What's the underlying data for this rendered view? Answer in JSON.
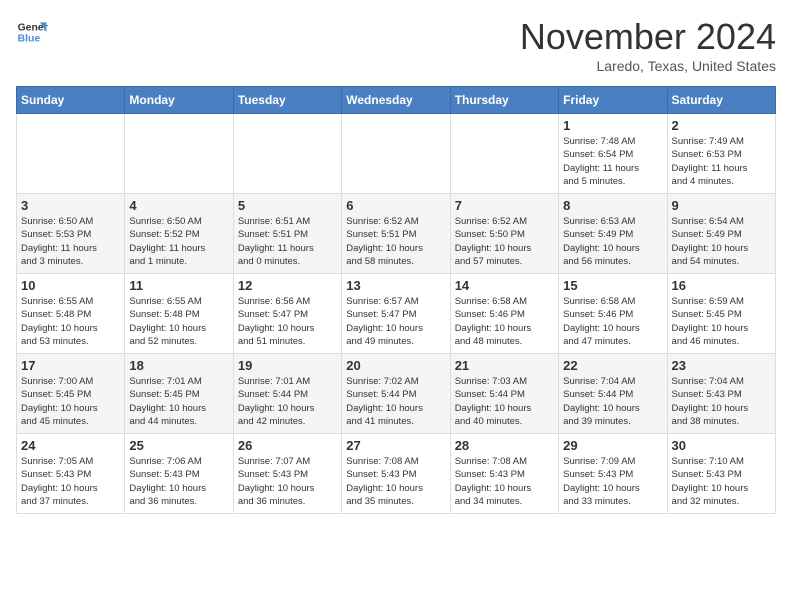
{
  "header": {
    "logo_line1": "General",
    "logo_line2": "Blue",
    "month": "November 2024",
    "location": "Laredo, Texas, United States"
  },
  "weekdays": [
    "Sunday",
    "Monday",
    "Tuesday",
    "Wednesday",
    "Thursday",
    "Friday",
    "Saturday"
  ],
  "weeks": [
    [
      {
        "day": "",
        "info": ""
      },
      {
        "day": "",
        "info": ""
      },
      {
        "day": "",
        "info": ""
      },
      {
        "day": "",
        "info": ""
      },
      {
        "day": "",
        "info": ""
      },
      {
        "day": "1",
        "info": "Sunrise: 7:48 AM\nSunset: 6:54 PM\nDaylight: 11 hours\nand 5 minutes."
      },
      {
        "day": "2",
        "info": "Sunrise: 7:49 AM\nSunset: 6:53 PM\nDaylight: 11 hours\nand 4 minutes."
      }
    ],
    [
      {
        "day": "3",
        "info": "Sunrise: 6:50 AM\nSunset: 5:53 PM\nDaylight: 11 hours\nand 3 minutes."
      },
      {
        "day": "4",
        "info": "Sunrise: 6:50 AM\nSunset: 5:52 PM\nDaylight: 11 hours\nand 1 minute."
      },
      {
        "day": "5",
        "info": "Sunrise: 6:51 AM\nSunset: 5:51 PM\nDaylight: 11 hours\nand 0 minutes."
      },
      {
        "day": "6",
        "info": "Sunrise: 6:52 AM\nSunset: 5:51 PM\nDaylight: 10 hours\nand 58 minutes."
      },
      {
        "day": "7",
        "info": "Sunrise: 6:52 AM\nSunset: 5:50 PM\nDaylight: 10 hours\nand 57 minutes."
      },
      {
        "day": "8",
        "info": "Sunrise: 6:53 AM\nSunset: 5:49 PM\nDaylight: 10 hours\nand 56 minutes."
      },
      {
        "day": "9",
        "info": "Sunrise: 6:54 AM\nSunset: 5:49 PM\nDaylight: 10 hours\nand 54 minutes."
      }
    ],
    [
      {
        "day": "10",
        "info": "Sunrise: 6:55 AM\nSunset: 5:48 PM\nDaylight: 10 hours\nand 53 minutes."
      },
      {
        "day": "11",
        "info": "Sunrise: 6:55 AM\nSunset: 5:48 PM\nDaylight: 10 hours\nand 52 minutes."
      },
      {
        "day": "12",
        "info": "Sunrise: 6:56 AM\nSunset: 5:47 PM\nDaylight: 10 hours\nand 51 minutes."
      },
      {
        "day": "13",
        "info": "Sunrise: 6:57 AM\nSunset: 5:47 PM\nDaylight: 10 hours\nand 49 minutes."
      },
      {
        "day": "14",
        "info": "Sunrise: 6:58 AM\nSunset: 5:46 PM\nDaylight: 10 hours\nand 48 minutes."
      },
      {
        "day": "15",
        "info": "Sunrise: 6:58 AM\nSunset: 5:46 PM\nDaylight: 10 hours\nand 47 minutes."
      },
      {
        "day": "16",
        "info": "Sunrise: 6:59 AM\nSunset: 5:45 PM\nDaylight: 10 hours\nand 46 minutes."
      }
    ],
    [
      {
        "day": "17",
        "info": "Sunrise: 7:00 AM\nSunset: 5:45 PM\nDaylight: 10 hours\nand 45 minutes."
      },
      {
        "day": "18",
        "info": "Sunrise: 7:01 AM\nSunset: 5:45 PM\nDaylight: 10 hours\nand 44 minutes."
      },
      {
        "day": "19",
        "info": "Sunrise: 7:01 AM\nSunset: 5:44 PM\nDaylight: 10 hours\nand 42 minutes."
      },
      {
        "day": "20",
        "info": "Sunrise: 7:02 AM\nSunset: 5:44 PM\nDaylight: 10 hours\nand 41 minutes."
      },
      {
        "day": "21",
        "info": "Sunrise: 7:03 AM\nSunset: 5:44 PM\nDaylight: 10 hours\nand 40 minutes."
      },
      {
        "day": "22",
        "info": "Sunrise: 7:04 AM\nSunset: 5:44 PM\nDaylight: 10 hours\nand 39 minutes."
      },
      {
        "day": "23",
        "info": "Sunrise: 7:04 AM\nSunset: 5:43 PM\nDaylight: 10 hours\nand 38 minutes."
      }
    ],
    [
      {
        "day": "24",
        "info": "Sunrise: 7:05 AM\nSunset: 5:43 PM\nDaylight: 10 hours\nand 37 minutes."
      },
      {
        "day": "25",
        "info": "Sunrise: 7:06 AM\nSunset: 5:43 PM\nDaylight: 10 hours\nand 36 minutes."
      },
      {
        "day": "26",
        "info": "Sunrise: 7:07 AM\nSunset: 5:43 PM\nDaylight: 10 hours\nand 36 minutes."
      },
      {
        "day": "27",
        "info": "Sunrise: 7:08 AM\nSunset: 5:43 PM\nDaylight: 10 hours\nand 35 minutes."
      },
      {
        "day": "28",
        "info": "Sunrise: 7:08 AM\nSunset: 5:43 PM\nDaylight: 10 hours\nand 34 minutes."
      },
      {
        "day": "29",
        "info": "Sunrise: 7:09 AM\nSunset: 5:43 PM\nDaylight: 10 hours\nand 33 minutes."
      },
      {
        "day": "30",
        "info": "Sunrise: 7:10 AM\nSunset: 5:43 PM\nDaylight: 10 hours\nand 32 minutes."
      }
    ]
  ]
}
